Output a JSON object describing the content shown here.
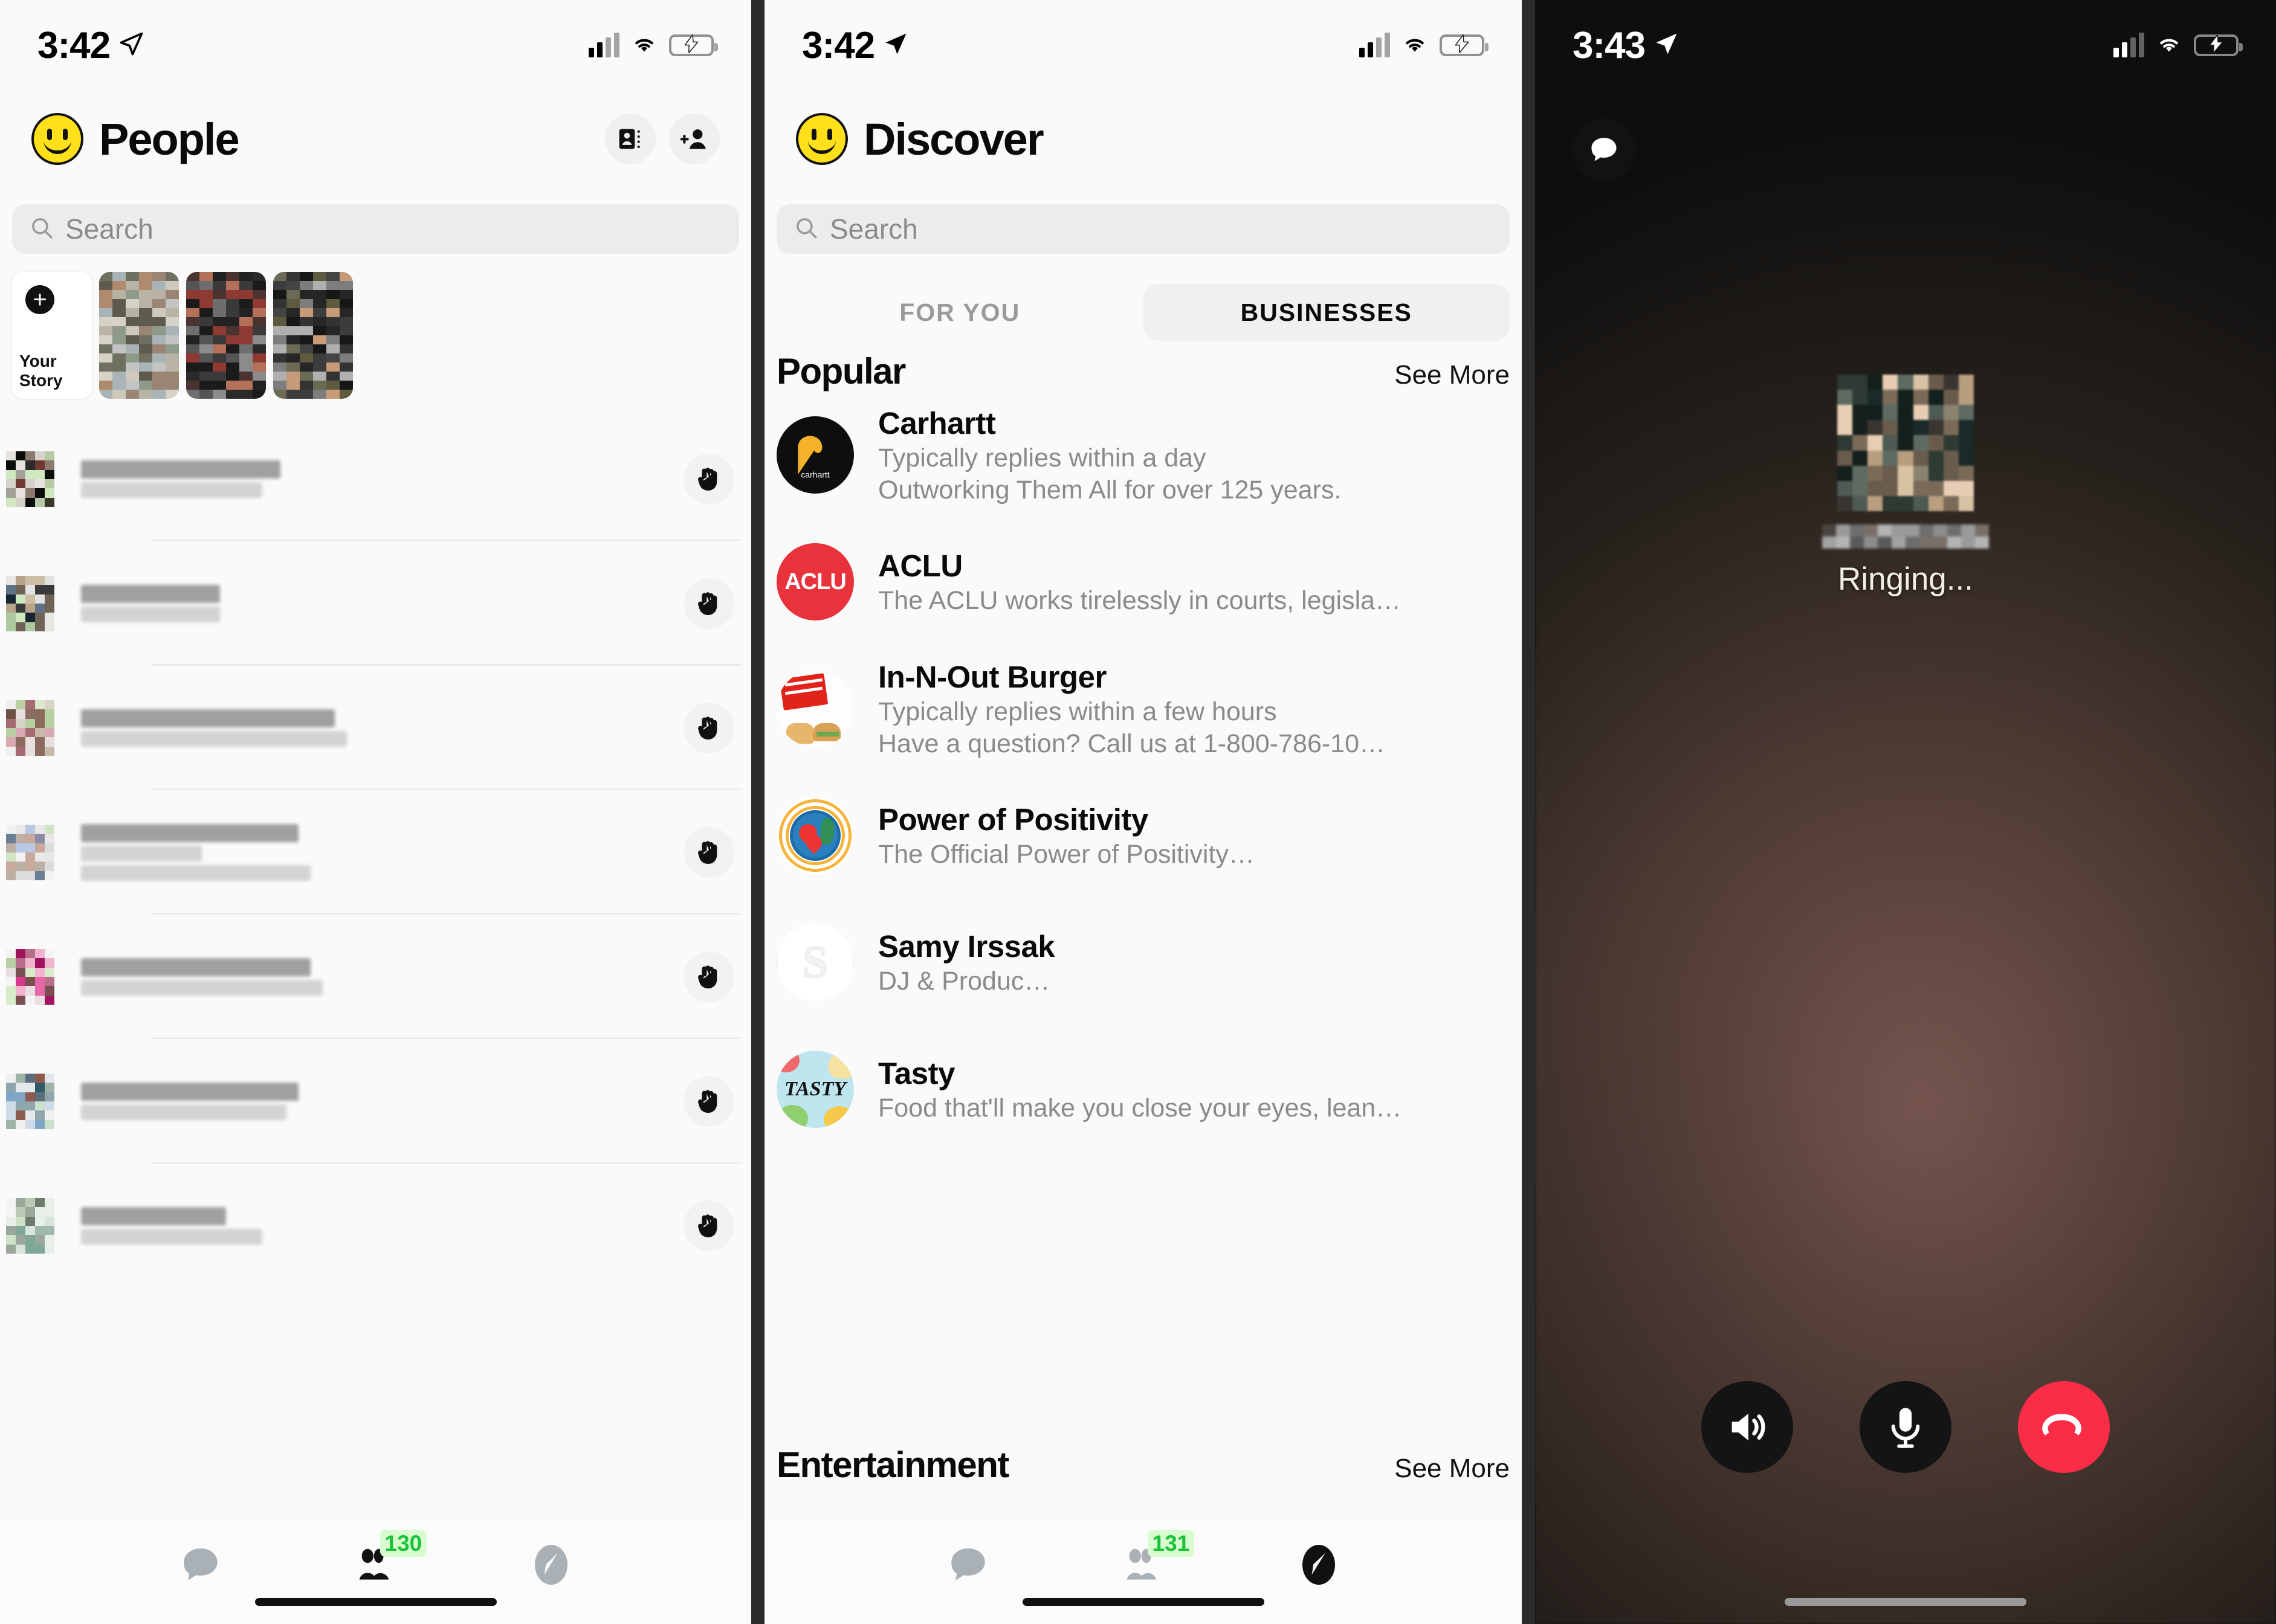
{
  "colors": {
    "accent_yellow": "#FFE01B",
    "badge_green_text": "#19C337",
    "badge_green_bg": "#D8FBD0",
    "end_call_red": "#FB2D46",
    "battery_green": "#3DDC55",
    "aclu_red": "#E8323C",
    "carhartt_gold": "#F3B229"
  },
  "panel_people": {
    "status_bar": {
      "time": "3:42",
      "location_icon": "location-arrow-icon",
      "signal_icon": "cellular-bars-icon",
      "wifi_icon": "wifi-icon",
      "battery_icon": "battery-charging-icon"
    },
    "header": {
      "logo_icon": "smiley-logo-icon",
      "title": "People",
      "action_contacts_icon": "contact-card-icon",
      "action_add_friend_icon": "add-person-icon"
    },
    "search": {
      "icon": "search-icon",
      "placeholder": "Search",
      "value": ""
    },
    "stories": {
      "your_story_label": "Your Story",
      "add_icon": "plus-icon",
      "items": [
        {
          "name": "your-story",
          "label": "Your Story",
          "redacted": false
        },
        {
          "name": "story-1",
          "label": "",
          "redacted": true
        },
        {
          "name": "story-2",
          "label": "",
          "redacted": true
        },
        {
          "name": "story-3",
          "label": "",
          "redacted": true
        }
      ]
    },
    "contacts": [
      {
        "name_redacted": true,
        "lines": 2,
        "wave_icon": "waving-hand-icon"
      },
      {
        "name_redacted": true,
        "lines": 2,
        "wave_icon": "waving-hand-icon"
      },
      {
        "name_redacted": true,
        "lines": 2,
        "wave_icon": "waving-hand-icon"
      },
      {
        "name_redacted": true,
        "lines": 3,
        "wave_icon": "waving-hand-icon"
      },
      {
        "name_redacted": true,
        "lines": 2,
        "wave_icon": "waving-hand-icon"
      },
      {
        "name_redacted": true,
        "lines": 2,
        "wave_icon": "waving-hand-icon"
      },
      {
        "name_redacted": true,
        "lines": 2,
        "wave_icon": "waving-hand-icon"
      }
    ],
    "tabbar": {
      "tabs": [
        {
          "name": "chats",
          "icon": "chat-bubble-icon",
          "active": false,
          "badge": ""
        },
        {
          "name": "people",
          "icon": "people-icon",
          "active": true,
          "badge": "130"
        },
        {
          "name": "compose",
          "icon": "pencil-compose-icon",
          "active": false,
          "badge": ""
        }
      ]
    }
  },
  "panel_discover": {
    "status_bar": {
      "time": "3:42",
      "location_icon": "location-arrow-icon",
      "signal_icon": "cellular-bars-icon",
      "wifi_icon": "wifi-icon",
      "battery_icon": "battery-charging-icon"
    },
    "header": {
      "logo_icon": "smiley-logo-icon",
      "title": "Discover"
    },
    "search": {
      "icon": "search-icon",
      "placeholder": "Search",
      "value": ""
    },
    "segments": [
      {
        "label": "FOR YOU",
        "selected": false
      },
      {
        "label": "BUSINESSES",
        "selected": true
      }
    ],
    "sections": [
      {
        "title": "Popular",
        "see_more": "See More"
      },
      {
        "title": "Entertainment",
        "see_more": "See More"
      }
    ],
    "businesses": [
      {
        "name": "Carhartt",
        "line1": "Typically replies within a day",
        "line2": "Outworking Them All for over 125 years.",
        "avatar": "carhartt-logo-icon"
      },
      {
        "name": "ACLU",
        "line1": "The ACLU works tirelessly in courts, legisla…",
        "line2": "",
        "avatar": "aclu-logo-icon"
      },
      {
        "name": "In-N-Out Burger",
        "line1": "Typically replies within a few hours",
        "line2": "Have a question?  Call us at 1-800-786-10…",
        "avatar": "in-n-out-logo-icon"
      },
      {
        "name": "Power of Positivity",
        "line1": "The Official Power of Positivity…",
        "line2": "",
        "avatar": "power-of-positivity-logo-icon"
      },
      {
        "name": "Samy Irssak",
        "line1": "DJ & Produc…",
        "line2": "",
        "avatar": "samy-irssak-logo-icon"
      },
      {
        "name": "Tasty",
        "line1": "Food that'll make you close your eyes, lean…",
        "line2": "",
        "avatar": "tasty-logo-icon"
      }
    ],
    "tabbar": {
      "tabs": [
        {
          "name": "chats",
          "icon": "chat-bubble-icon",
          "active": false,
          "badge": ""
        },
        {
          "name": "people",
          "icon": "people-icon",
          "active": false,
          "badge": "131"
        },
        {
          "name": "compose",
          "icon": "pencil-compose-icon",
          "active": true,
          "badge": ""
        }
      ]
    }
  },
  "panel_call": {
    "status_bar": {
      "time": "3:43",
      "location_icon": "location-arrow-icon",
      "signal_icon": "cellular-bars-icon",
      "wifi_icon": "wifi-icon",
      "battery_icon": "battery-charging-icon"
    },
    "message_button_icon": "chat-bubble-icon",
    "callee": {
      "avatar_redacted": true,
      "name_redacted": true,
      "status": "Ringing..."
    },
    "controls": [
      {
        "name": "speaker",
        "icon": "speaker-icon",
        "style": "dark"
      },
      {
        "name": "mute",
        "icon": "microphone-icon",
        "style": "dark"
      },
      {
        "name": "end-call",
        "icon": "end-call-icon",
        "style": "red"
      }
    ]
  }
}
